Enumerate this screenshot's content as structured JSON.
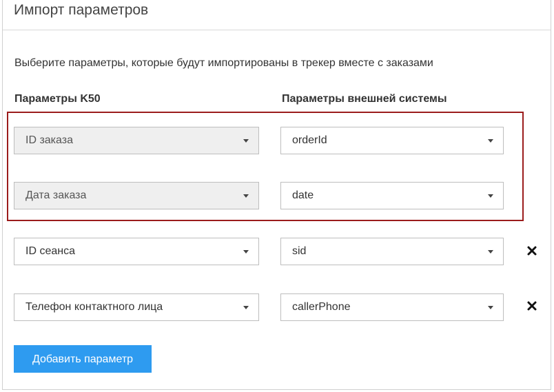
{
  "header": {
    "title": "Импорт параметров"
  },
  "description": "Выберите параметры, которые будут импортированы в трекер вместе с заказами",
  "columns": {
    "left": "Параметры K50",
    "right": "Параметры внешней системы"
  },
  "rows": [
    {
      "k50_param": "ID заказа",
      "external_param": "orderId",
      "k50_disabled": true,
      "removable": false
    },
    {
      "k50_param": "Дата заказа",
      "external_param": "date",
      "k50_disabled": true,
      "removable": false
    },
    {
      "k50_param": "ID сеанса",
      "external_param": "sid",
      "k50_disabled": false,
      "removable": true
    },
    {
      "k50_param": "Телефон контактного лица",
      "external_param": "callerPhone",
      "k50_disabled": false,
      "removable": true
    }
  ],
  "icons": {
    "select_caret": "caret-down-icon",
    "remove": "close-icon"
  },
  "add_button": {
    "label": "Добавить параметр"
  },
  "colors": {
    "accent_button": "#2e9bf0",
    "highlight_border": "#9b1b1b",
    "disabled_field": "#efefef"
  }
}
